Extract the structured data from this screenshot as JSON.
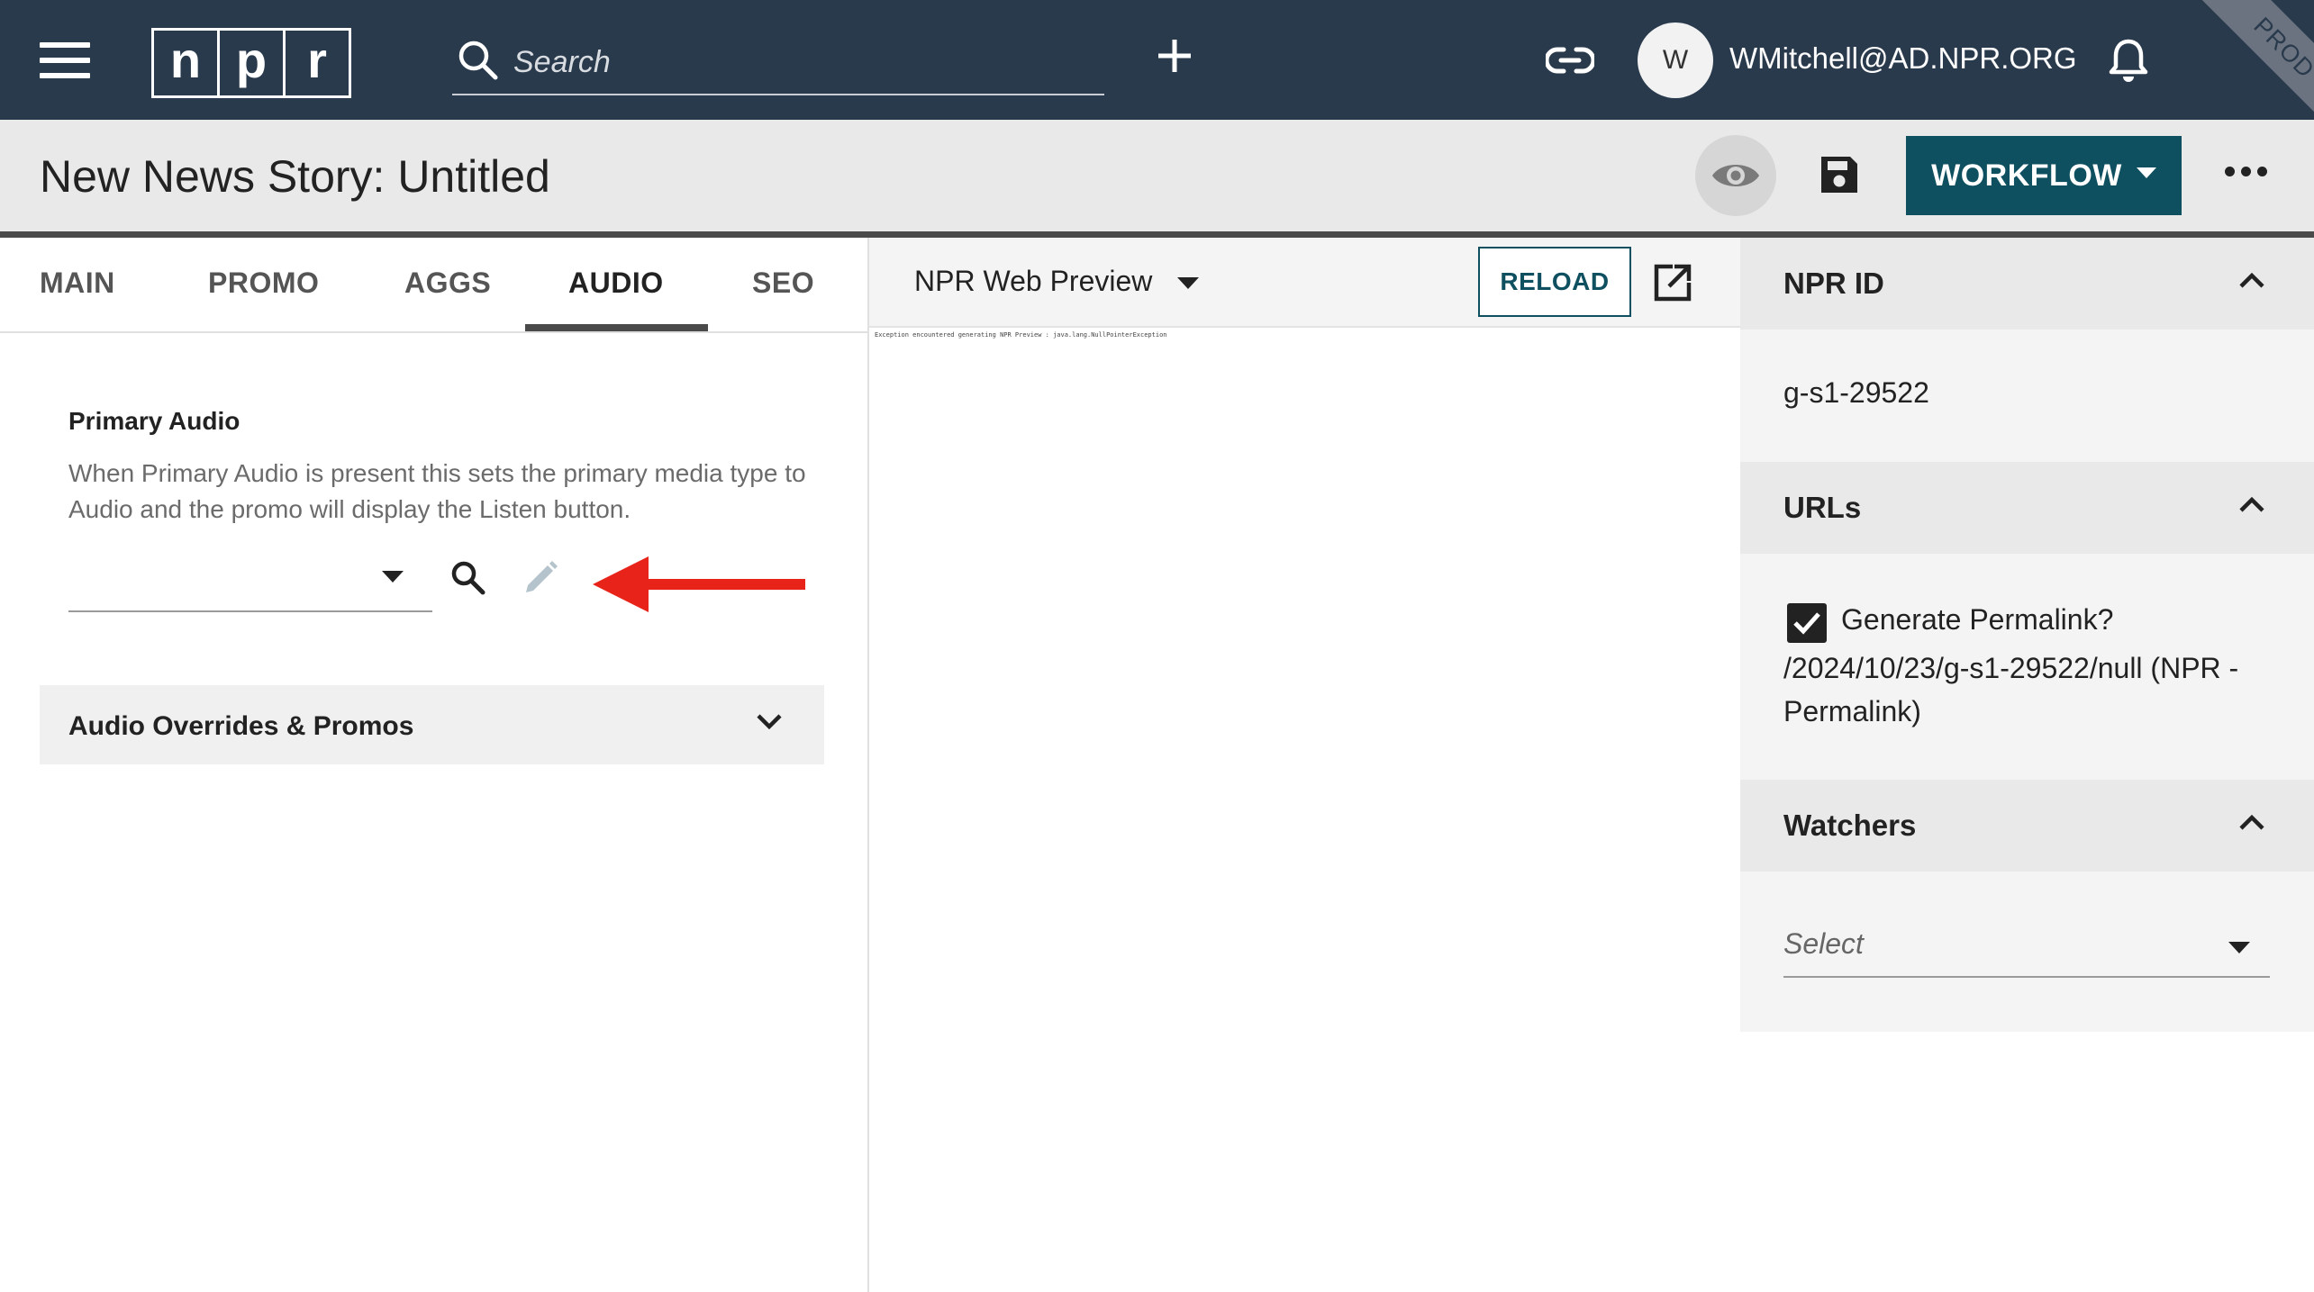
{
  "header": {
    "logo_letters": [
      "n",
      "p",
      "r"
    ],
    "search_placeholder": "Search",
    "avatar_initial": "W",
    "username": "WMitchell@AD.NPR.ORG",
    "environment_badge": "PROD",
    "icons": [
      "menu-icon",
      "search-icon",
      "plus-icon",
      "link-icon",
      "bell-icon"
    ]
  },
  "titlebar": {
    "title": "New News Story: Untitled",
    "workflow_label": "WORKFLOW",
    "icons": [
      "eye-icon",
      "save-icon",
      "more-icon"
    ]
  },
  "tabs": [
    {
      "label": "MAIN",
      "active": false
    },
    {
      "label": "PROMO",
      "active": false
    },
    {
      "label": "AGGS",
      "active": false
    },
    {
      "label": "AUDIO",
      "active": true
    },
    {
      "label": "SEO",
      "active": false
    }
  ],
  "audio": {
    "primary_label": "Primary Audio",
    "primary_help": "When Primary Audio is present this sets the primary media type to Audio and the promo will display the Listen button.",
    "selected_value": "",
    "overrides_label": "Audio Overrides & Promos"
  },
  "preview": {
    "selected": "NPR Web Preview",
    "reload_label": "RELOAD",
    "error_text": "Exception encountered generating NPR Preview : java.lang.NullPointerException"
  },
  "sidebar": {
    "npr_id": {
      "title": "NPR ID",
      "value": "g-s1-29522"
    },
    "urls": {
      "title": "URLs",
      "generate_label": "Generate Permalink?",
      "generate_checked": true,
      "permalink": "/2024/10/23/g-s1-29522/null (NPR - Permalink)"
    },
    "watchers": {
      "title": "Watchers",
      "placeholder": "Select"
    }
  },
  "colors": {
    "header_bg": "#2a3a4d",
    "workflow_bg": "#0f5060",
    "annotation_arrow": "#e8241a"
  }
}
